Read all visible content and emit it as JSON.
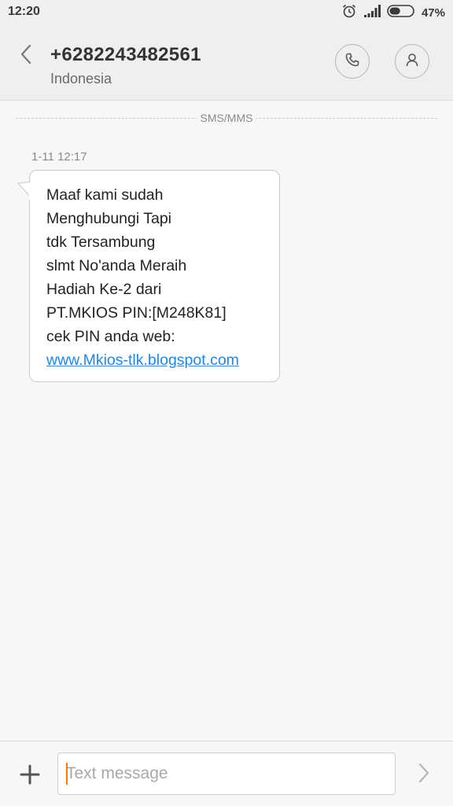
{
  "status_bar": {
    "time": "12:20",
    "battery_percent": "47%",
    "battery_level": 0.47,
    "icons": [
      "alarm-icon",
      "signal-icon",
      "battery-icon"
    ]
  },
  "header": {
    "back_icon": "chevron-left-icon",
    "contact_number": "+6282243482561",
    "contact_country": "Indonesia",
    "call_icon": "phone-icon",
    "profile_icon": "person-icon"
  },
  "conversation": {
    "divider_label": "SMS/MMS",
    "messages": [
      {
        "timestamp": "1-11 12:17",
        "lines": [
          "Maaf kami sudah",
          "Menghubungi Tapi",
          "tdk Tersambung",
          "slmt No'anda Meraih",
          "Hadiah Ke-2 dari",
          "PT.MKIOS PIN:[M248K81]",
          "cek PIN anda web:"
        ],
        "link": "www.Mkios-tlk.blogspot.com"
      }
    ]
  },
  "composer": {
    "add_icon": "plus-icon",
    "placeholder": "Text message",
    "value": "",
    "send_icon": "chevron-right-icon"
  },
  "colors": {
    "header_bg": "#efefef",
    "page_bg": "#f7f7f7",
    "link": "#1e88e5",
    "cursor": "#ff7a00"
  }
}
